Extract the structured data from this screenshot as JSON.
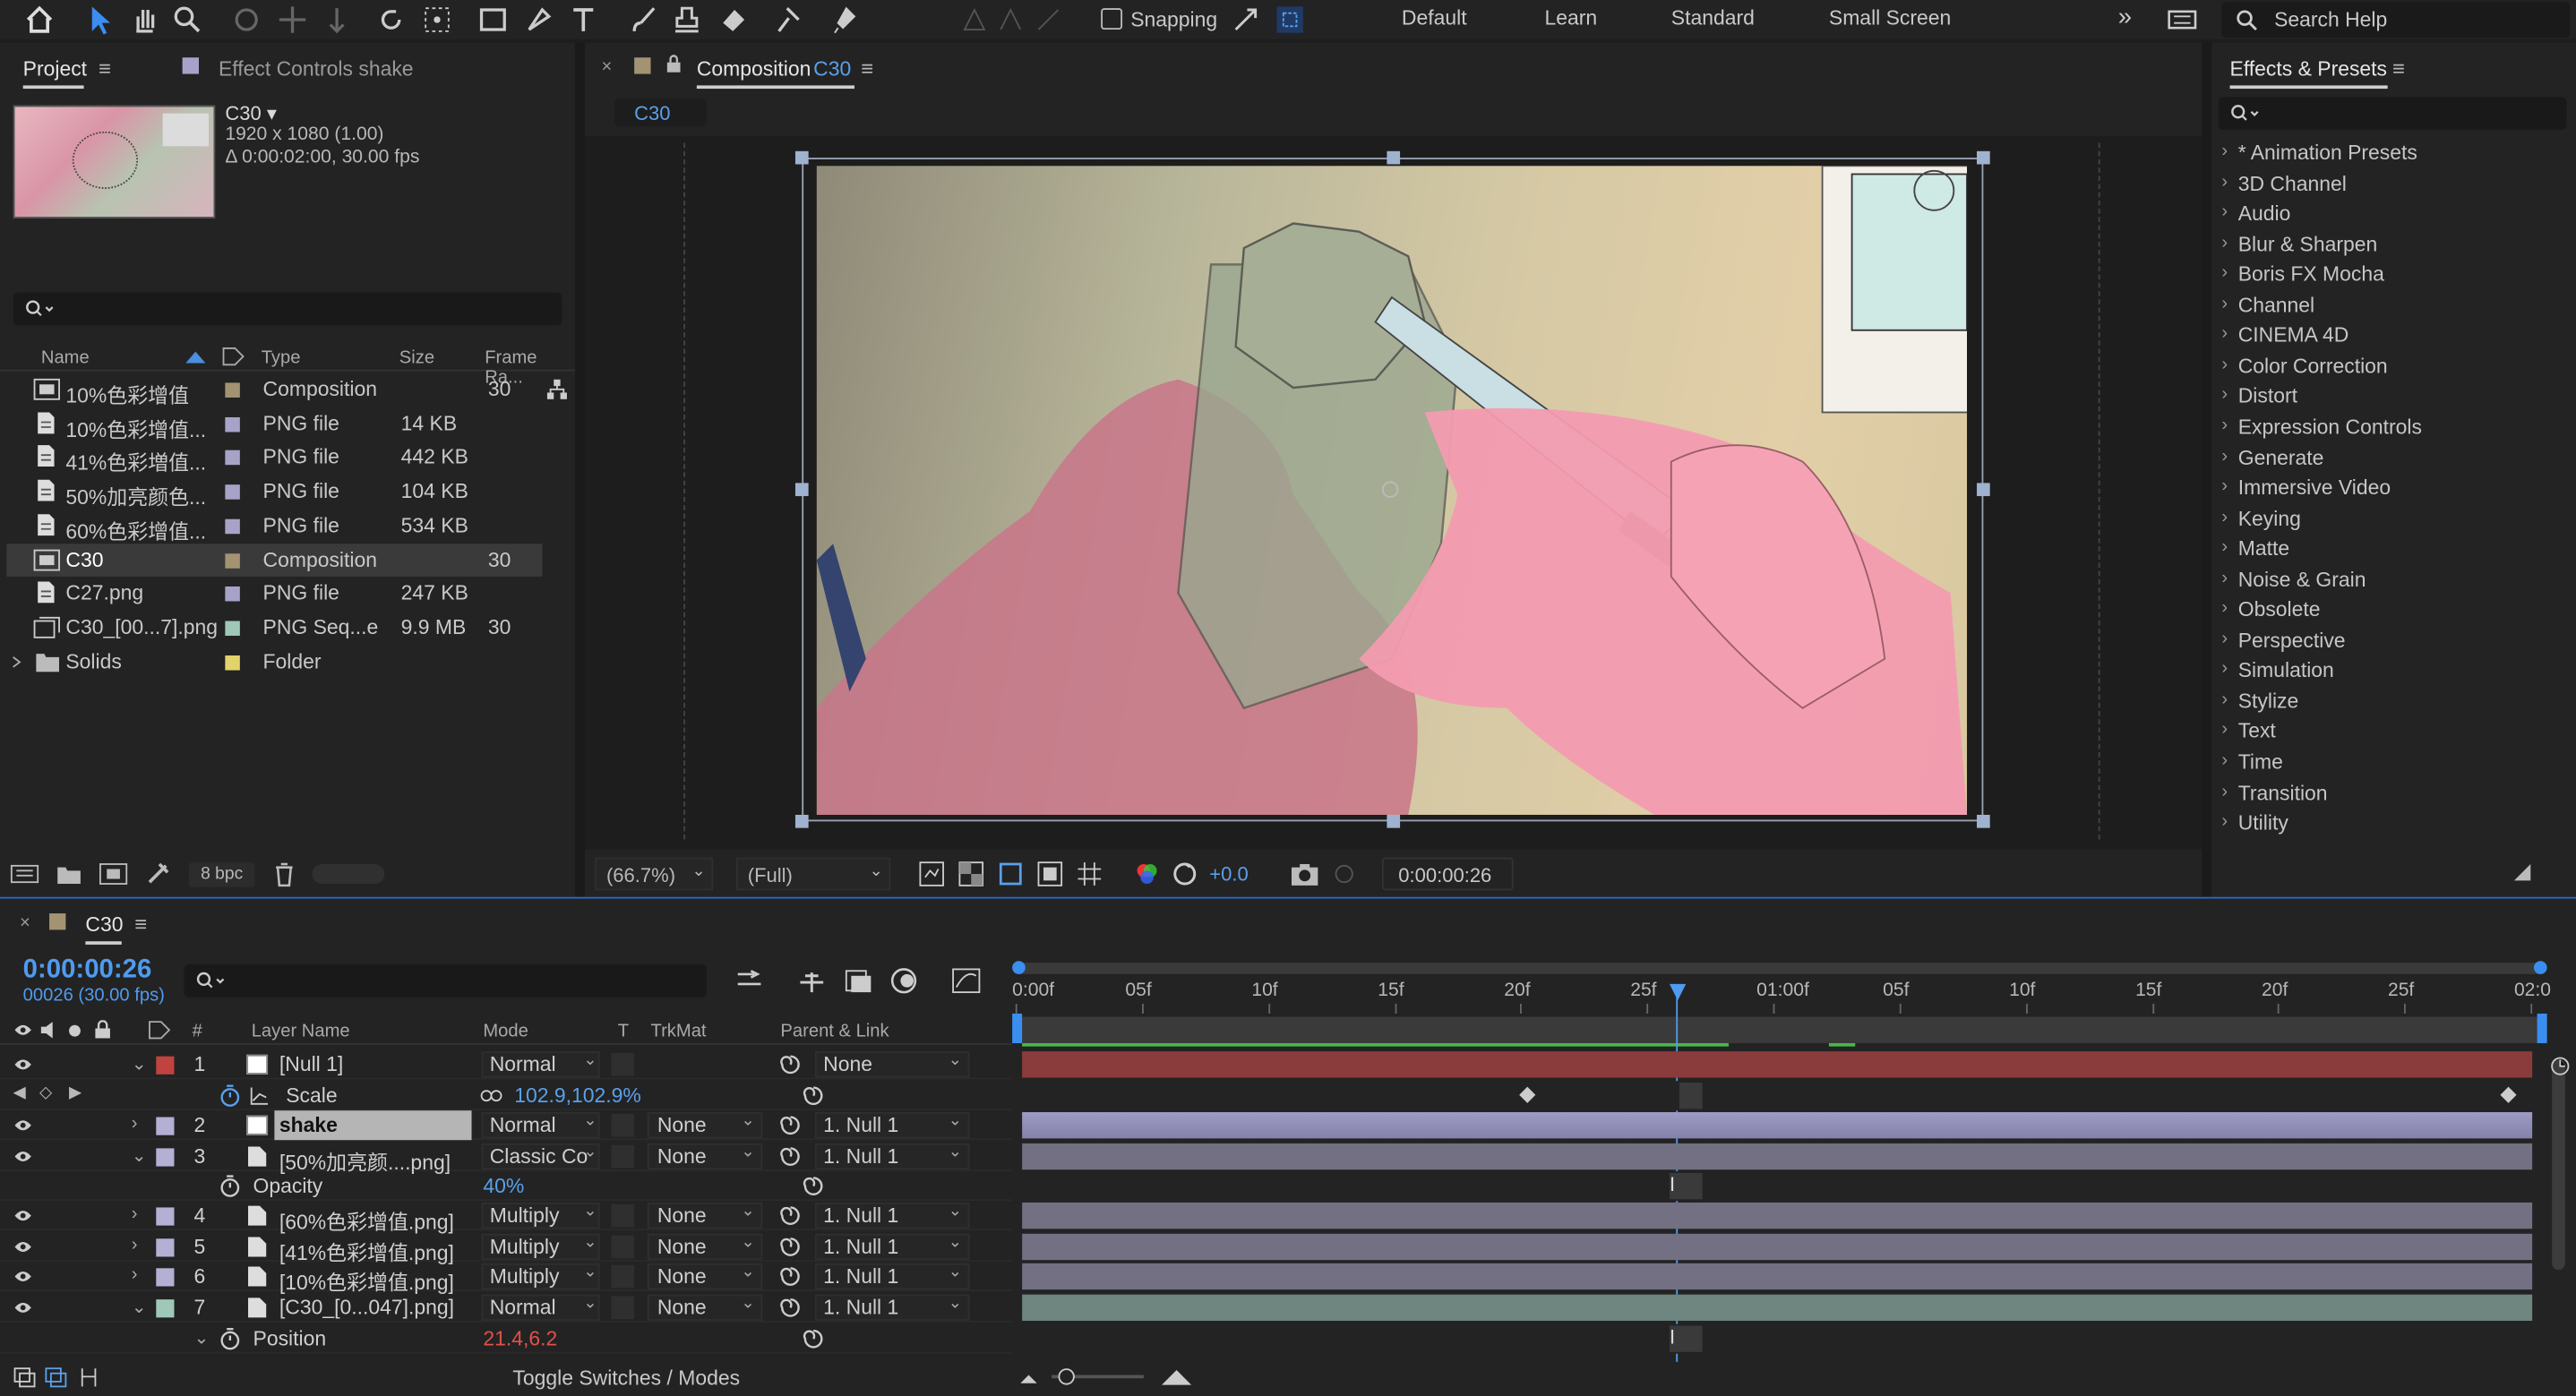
{
  "toolbar": {
    "snapping": "Snapping",
    "workspaces": [
      "Default",
      "Learn",
      "Standard",
      "Small Screen"
    ],
    "search": "Search Help"
  },
  "project": {
    "tab": "Project",
    "effect_controls_tab": "Effect Controls shake",
    "thumb_name": "C30 ▾",
    "thumb_info1": "1920 x 1080 (1.00)",
    "thumb_info2": "Δ 0:00:02:00, 30.00 fps",
    "headers": {
      "name": "Name",
      "type": "Type",
      "size": "Size",
      "frame_rate": "Frame Ra..."
    },
    "items": [
      {
        "name": "10%色彩增值",
        "type": "Composition",
        "size": "",
        "fps": "30",
        "color": "#a39372"
      },
      {
        "name": "10%色彩增值...",
        "type": "PNG file",
        "size": "14 KB",
        "fps": "",
        "color": "#a7a3c8"
      },
      {
        "name": "41%色彩増值...",
        "type": "PNG file",
        "size": "442 KB",
        "fps": "",
        "color": "#a7a3c8"
      },
      {
        "name": "50%加亮颜色...",
        "type": "PNG file",
        "size": "104 KB",
        "fps": "",
        "color": "#a7a3c8"
      },
      {
        "name": "60%色彩增值...",
        "type": "PNG file",
        "size": "534 KB",
        "fps": "",
        "color": "#a7a3c8"
      },
      {
        "name": "C30",
        "type": "Composition",
        "size": "",
        "fps": "30",
        "color": "#a39372"
      },
      {
        "name": "C27.png",
        "type": "PNG file",
        "size": "247 KB",
        "fps": "",
        "color": "#a7a3c8"
      },
      {
        "name": "C30_[00...7].png",
        "type": "PNG Seq...e",
        "size": "9.9 MB",
        "fps": "30",
        "color": "#9fc8b8"
      },
      {
        "name": "Solids",
        "type": "Folder",
        "size": "",
        "fps": "",
        "color": "#e2d36c"
      }
    ],
    "bpc": "8 bpc"
  },
  "composition": {
    "tab_prefix": "Composition",
    "tab_name": "C30",
    "subtab": "C30",
    "zoom": "(66.7%)",
    "resolution": "(Full)",
    "exposure": "+0.0",
    "timecode": "0:00:00:26"
  },
  "effects": {
    "title": "Effects & Presets",
    "items": [
      "* Animation Presets",
      "3D Channel",
      "Audio",
      "Blur & Sharpen",
      "Boris FX Mocha",
      "Channel",
      "CINEMA 4D",
      "Color Correction",
      "Distort",
      "Expression Controls",
      "Generate",
      "Immersive Video",
      "Keying",
      "Matte",
      "Noise & Grain",
      "Obsolete",
      "Perspective",
      "Simulation",
      "Stylize",
      "Text",
      "Time",
      "Transition",
      "Utility"
    ]
  },
  "timeline": {
    "tab": "C30",
    "timecode": "0:00:00:26",
    "frames": "00026 (30.00 fps)",
    "headers": {
      "layer_name": "Layer Name",
      "mode": "Mode",
      "t": "T",
      "trkmat": "TrkMat",
      "parent": "Parent & Link"
    },
    "ruler": [
      "0:00f",
      "05f",
      "10f",
      "15f",
      "20f",
      "25f",
      "01:00f",
      "05f",
      "10f",
      "15f",
      "20f",
      "25f",
      "02:0"
    ],
    "rows": [
      {
        "kind": "layer",
        "num": "1",
        "name": "[Null 1]",
        "mode": "Normal",
        "trkmat": "",
        "parent": "None",
        "color": "#c0433f",
        "bar": "#8a3b3b"
      },
      {
        "kind": "prop",
        "name": "Scale",
        "value": "102.9,102.9%",
        "value_color": "#5aa0ea"
      },
      {
        "kind": "layer",
        "num": "2",
        "name": "shake",
        "mode": "Normal",
        "trkmat": "None",
        "parent": "1. Null 1",
        "color": "#b3b0d4",
        "bar": "#8c8aae"
      },
      {
        "kind": "layer",
        "num": "3",
        "name": "[50%加亮颜....png]",
        "mode": "Classic Co",
        "trkmat": "None",
        "parent": "1. Null 1",
        "color": "#b3b0d4",
        "bar": "#727082"
      },
      {
        "kind": "prop",
        "name": "Opacity",
        "value": "40%",
        "value_color": "#5aa0ea"
      },
      {
        "kind": "layer",
        "num": "4",
        "name": "[60%色彩增值.png]",
        "mode": "Multiply",
        "trkmat": "None",
        "parent": "1. Null 1",
        "color": "#b3b0d4",
        "bar": "#727082"
      },
      {
        "kind": "layer",
        "num": "5",
        "name": "[41%色彩增值.png]",
        "mode": "Multiply",
        "trkmat": "None",
        "parent": "1. Null 1",
        "color": "#b3b0d4",
        "bar": "#727082"
      },
      {
        "kind": "layer",
        "num": "6",
        "name": "[10%色彩增值.png]",
        "mode": "Multiply",
        "trkmat": "None",
        "parent": "1. Null 1",
        "color": "#b3b0d4",
        "bar": "#727082"
      },
      {
        "kind": "layer",
        "num": "7",
        "name": "[C30_[0...047].png]",
        "mode": "Normal",
        "trkmat": "None",
        "parent": "1. Null 1",
        "color": "#9fc8b8",
        "bar": "#6e8580"
      },
      {
        "kind": "prop",
        "name": "Position",
        "value": "21.4,6.2",
        "value_color": "#e0514a"
      }
    ],
    "toggle": "Toggle Switches / Modes"
  }
}
